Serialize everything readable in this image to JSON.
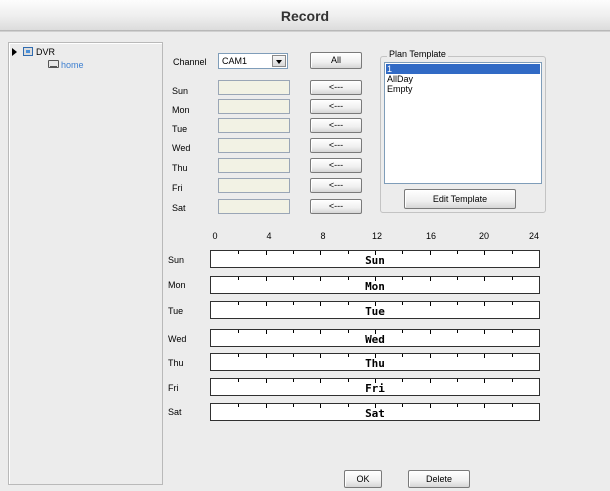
{
  "window": {
    "title": "Record"
  },
  "tree": {
    "root": "DVR",
    "child": "home"
  },
  "channel": {
    "label": "Channel",
    "value": "CAM1"
  },
  "toolbar": {
    "all_label": "All"
  },
  "days": [
    {
      "label": "Sun",
      "button": "<---"
    },
    {
      "label": "Mon",
      "button": "<---"
    },
    {
      "label": "Tue",
      "button": "<---"
    },
    {
      "label": "Wed",
      "button": "<---"
    },
    {
      "label": "Thu",
      "button": "<---"
    },
    {
      "label": "Fri",
      "button": "<---"
    },
    {
      "label": "Sat",
      "button": "<---"
    }
  ],
  "plan_template": {
    "legend": "Plan Template",
    "items": [
      "1",
      "AllDay",
      "Empty"
    ],
    "selected_index": 0,
    "edit_label": "Edit Template"
  },
  "timeline": {
    "scale": [
      "0",
      "4",
      "8",
      "12",
      "16",
      "20",
      "24"
    ],
    "rows": [
      {
        "label": "Sun",
        "text": "Sun"
      },
      {
        "label": "Mon",
        "text": "Mon"
      },
      {
        "label": "Tue",
        "text": "Tue"
      },
      {
        "label": "Wed",
        "text": "Wed"
      },
      {
        "label": "Thu",
        "text": "Thu"
      },
      {
        "label": "Fri",
        "text": "Fri"
      },
      {
        "label": "Sat",
        "text": "Sat"
      }
    ]
  },
  "footer": {
    "ok_label": "OK",
    "delete_label": "Delete"
  },
  "colors": {
    "selection": "#316ac5",
    "tree_child": "#3d7fd0",
    "day_input_bg": "#f2f2e4"
  }
}
